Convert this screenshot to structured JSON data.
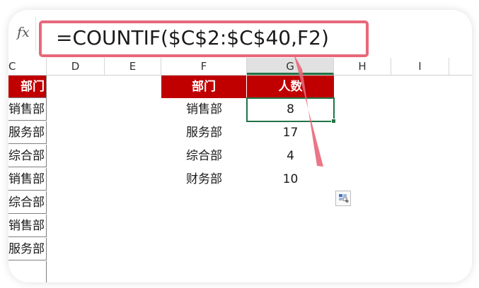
{
  "formula_bar": {
    "fx_label": "fx",
    "formula": "=COUNTIF($C$2:$C$40,F2)"
  },
  "columns": [
    "C",
    "D",
    "E",
    "F",
    "G",
    "H",
    "I"
  ],
  "column_c_cells": [
    "部门",
    "销售部",
    "服务部",
    "综合部",
    "销售部",
    "综合部",
    "销售部",
    "服务部"
  ],
  "table": {
    "headers": [
      "部门",
      "人数"
    ],
    "rows": [
      {
        "dept": "销售部",
        "count": "8"
      },
      {
        "dept": "服务部",
        "count": "17"
      },
      {
        "dept": "综合部",
        "count": "4"
      },
      {
        "dept": "财务部",
        "count": "10"
      }
    ]
  },
  "colors": {
    "header_fill": "#c00000",
    "selection": "#217346",
    "callout": "#e8687a"
  },
  "icons": {
    "quick_analysis": "quick-analysis-icon"
  }
}
